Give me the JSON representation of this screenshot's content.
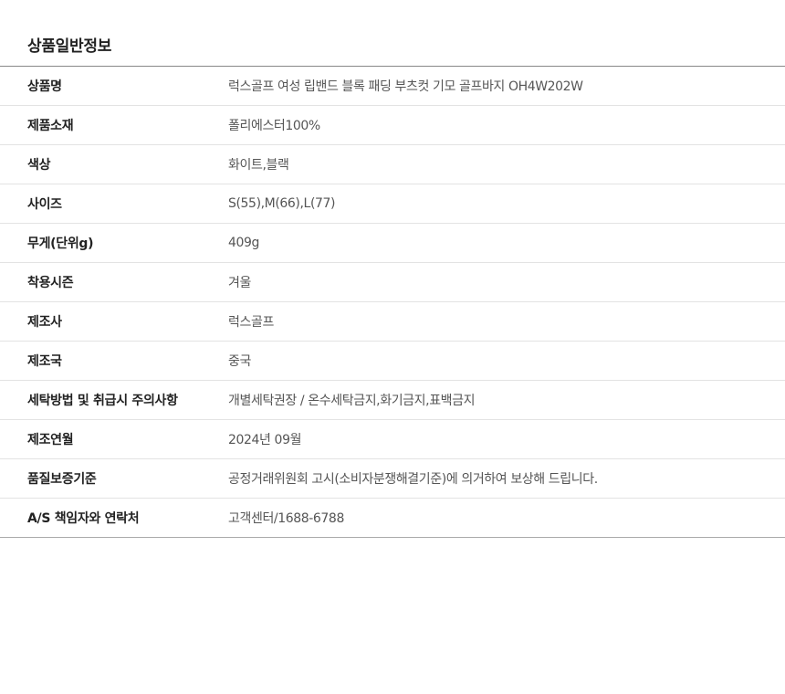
{
  "section": {
    "title": "상품일반정보"
  },
  "rows": [
    {
      "label": "상품명",
      "value": "럭스골프 여성 립밴드 블록 패딩 부츠컷 기모 골프바지 OH4W202W"
    },
    {
      "label": "제품소재",
      "value": "폴리에스터100%"
    },
    {
      "label": "색상",
      "value": "화이트,블랙"
    },
    {
      "label": "사이즈",
      "value": "S(55),M(66),L(77)"
    },
    {
      "label": "무게(단위g)",
      "value": "409g"
    },
    {
      "label": "착용시즌",
      "value": "겨울"
    },
    {
      "label": "제조사",
      "value": "럭스골프"
    },
    {
      "label": "제조국",
      "value": "중국"
    },
    {
      "label": "세탁방법 및 취급시 주의사항",
      "value": "개별세탁권장 / 온수세탁금지,화기금지,표백금지"
    },
    {
      "label": "제조연월",
      "value": "2024년 09월"
    },
    {
      "label": "품질보증기준",
      "value": "공정거래위원회 고시(소비자분쟁해결기준)에 의거하여  보상해 드립니다."
    },
    {
      "label": "A/S 책임자와 연락처",
      "value": "고객센터/1688-6788"
    }
  ]
}
